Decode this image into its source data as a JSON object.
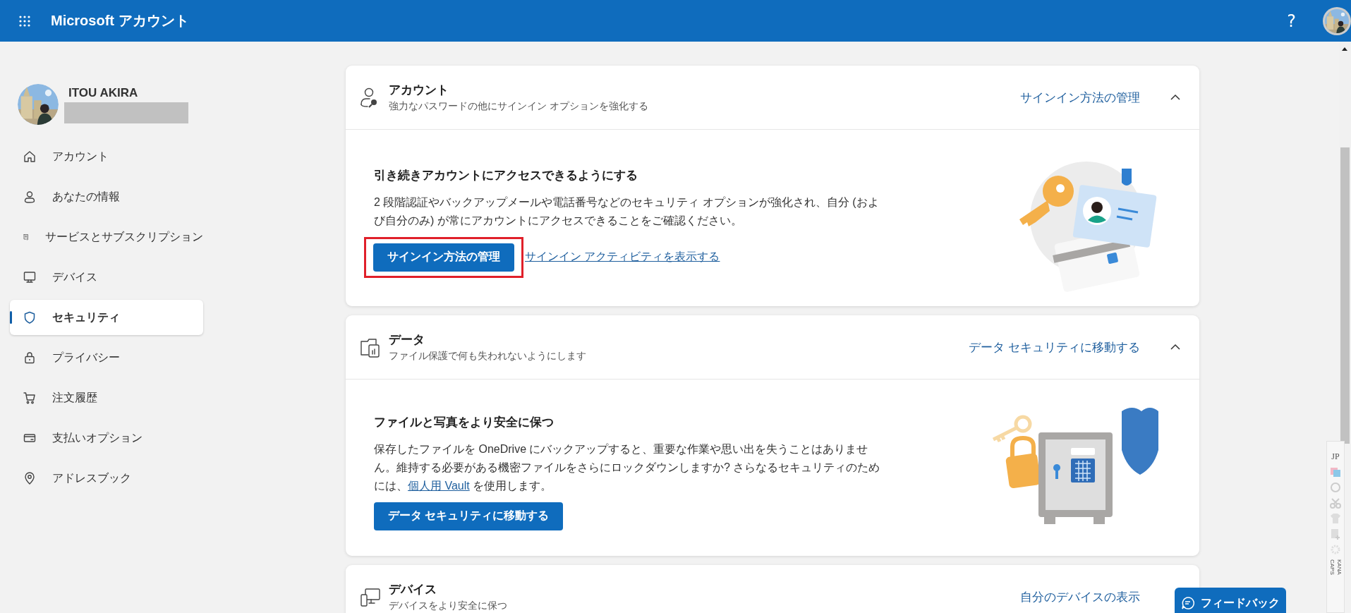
{
  "header": {
    "app_title": "Microsoft アカウント",
    "help": "?"
  },
  "profile": {
    "name": "ITOU AKIRA"
  },
  "nav": [
    {
      "label": "アカウント",
      "selected": false
    },
    {
      "label": "あなたの情報",
      "selected": false
    },
    {
      "label": "サービスとサブスクリプション",
      "selected": false
    },
    {
      "label": "デバイス",
      "selected": false
    },
    {
      "label": "セキュリティ",
      "selected": true
    },
    {
      "label": "プライバシー",
      "selected": false
    },
    {
      "label": "注文履歴",
      "selected": false
    },
    {
      "label": "支払いオプション",
      "selected": false
    },
    {
      "label": "アドレスブック",
      "selected": false
    }
  ],
  "cards": [
    {
      "title": "アカウント",
      "subtitle": "強力なパスワードの他にサインイン オプションを強化する",
      "action": "サインイン方法の管理",
      "expanded": true,
      "body": {
        "heading": "引き続きアカウントにアクセスできるようにする",
        "text": "2 段階認証やバックアップメールや電話番号などのセキュリティ オプションが強化され、自分 (および自分のみ) が常にアカウントにアクセスできることをご確認ください。",
        "button": {
          "label": "サインイン方法の管理",
          "highlighted": true
        },
        "link": "サインイン アクティビティを表示する"
      }
    },
    {
      "title": "データ",
      "subtitle": "ファイル保護で何も失われないようにします",
      "action": "データ セキュリティに移動する",
      "expanded": true,
      "body": {
        "heading": "ファイルと写真をより安全に保つ",
        "text": "保存したファイルを OneDrive にバックアップすると、重要な作業や思い出を失うことはありません。維持する必要がある機密ファイルをさらにロックダウンしますか? さらなるセキュリティのためには、",
        "inline_link": "個人用 Vault",
        "text_after": " を使用します。",
        "button": {
          "label": "データ セキュリティに移動する",
          "highlighted": false
        }
      }
    },
    {
      "title": "デバイス",
      "subtitle": "デバイスをより安全に保つ",
      "action": "自分のデバイスの表示"
    }
  ],
  "feedback": {
    "label": "フィードバック"
  },
  "ime_toolbar": {
    "language": "JP",
    "caps": "CAPS",
    "kana": "KANA"
  }
}
